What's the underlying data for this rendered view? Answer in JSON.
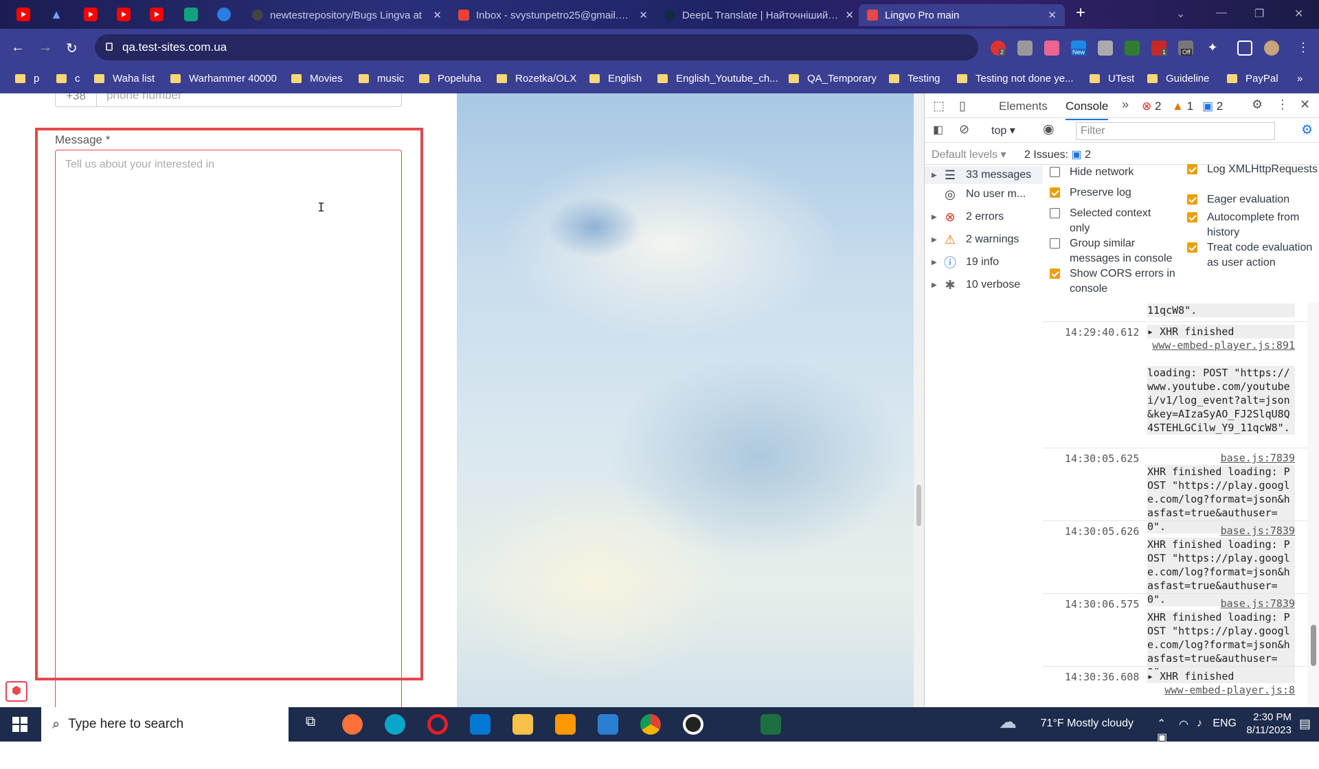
{
  "browser": {
    "tabs": [
      {
        "title": "newtestrepository/Bugs Lingva at"
      },
      {
        "title": "Inbox - svystunpetro25@gmail.com"
      },
      {
        "title": "DeepL Translate | Найточніший перекладач"
      },
      {
        "title": "Lingvo Pro main"
      }
    ],
    "url": "qa.test-sites.com.ua",
    "ext_badges": {
      "adblock": "2",
      "new": "New",
      "off": "Off",
      "one": "1"
    },
    "bookmarks": [
      "p",
      "c",
      "Waha list",
      "Warhammer 40000",
      "Movies",
      "music",
      "Popeluha",
      "Rozetka/OLX",
      "English",
      "English_Youtube_ch...",
      "QA_Temporary",
      "Testing",
      "Testing not done ye...",
      "UTest",
      "Guideline",
      "PayPal"
    ]
  },
  "page": {
    "phone_code": "+38",
    "phone_placeholder": "phone number",
    "message_label": "Message *",
    "message_placeholder": "Tell us about your interested in"
  },
  "devtools": {
    "tabs": {
      "elements": "Elements",
      "console": "Console"
    },
    "errors": "2",
    "warnings": "1",
    "issues_count": "2",
    "context": "top",
    "filter_placeholder": "Filter",
    "levels": "Default levels",
    "issues_label": "2 Issues:",
    "issues_num": "2",
    "sidebar": [
      {
        "label": "33 messages",
        "icon": "list-icon"
      },
      {
        "label": "No user m...",
        "icon": "user-icon"
      },
      {
        "label": "2 errors",
        "icon": "error-icon"
      },
      {
        "label": "2 warnings",
        "icon": "warning-icon"
      },
      {
        "label": "19 info",
        "icon": "info-icon"
      },
      {
        "label": "10 verbose",
        "icon": "bug-icon"
      }
    ],
    "settings_left": [
      {
        "label": "Hide network",
        "checked": false
      },
      {
        "label": "Preserve log",
        "checked": true
      },
      {
        "label": "Selected context only",
        "checked": false
      },
      {
        "label": "Group similar messages in console",
        "checked": false
      },
      {
        "label": "Show CORS errors in console",
        "checked": true
      }
    ],
    "settings_right": [
      {
        "label": "Log XMLHttpRequests",
        "checked": true
      },
      {
        "label": "Eager evaluation",
        "checked": true
      },
      {
        "label": "Autocomplete from history",
        "checked": true
      },
      {
        "label": "Treat code evaluation as user action",
        "checked": true
      }
    ],
    "logs": {
      "top_tail": "11qcW8\".",
      "e1_time": "14:29:40.612",
      "e1_head": "XHR finished",
      "e1_src": "www-embed-player.js:891",
      "e1_body": "loading: POST \"https://www.youtube.com/youtubei/v1/log_event?alt=json&key=AIzaSyAO_FJ2SlqU8Q4STEHLGCilw_Y9_11qcW8\".",
      "e2_time": "14:30:05.625",
      "e2_src": "base.js:7839",
      "e2_body": "XHR finished loading: POST \"https://play.google.com/log?format=json&hasfast=true&authuser=0\".",
      "e3_time": "14:30:05.626",
      "e3_src": "base.js:7839",
      "e3_body": "XHR finished loading: POST \"https://play.google.com/log?format=json&hasfast=true&authuser=0\".",
      "e4_time": "14:30:06.575",
      "e4_src": "base.js:7839",
      "e4_body": "XHR finished loading: POST \"https://play.google.com/log?format=json&hasfast=true&authuser=0\".",
      "e5_time": "14:30:36.608",
      "e5_head": "XHR finished",
      "e5_src": "www-embed-player.js:8"
    }
  },
  "taskbar": {
    "search_placeholder": "Type here to search",
    "weather": "71°F  Mostly cloudy",
    "lang": "ENG",
    "time": "2:30 PM",
    "date": "8/11/2023"
  }
}
